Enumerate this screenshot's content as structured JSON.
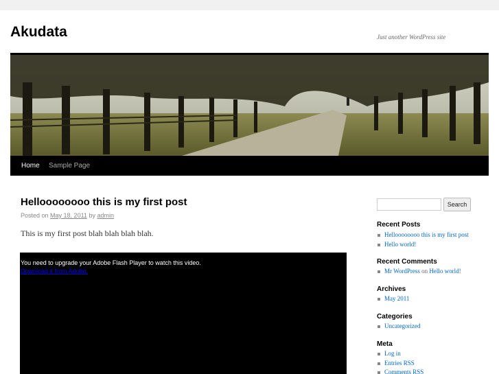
{
  "site": {
    "title": "Akudata",
    "description": "Just another WordPress site"
  },
  "nav": {
    "items": [
      {
        "label": "Home",
        "active": true
      },
      {
        "label": "Sample Page",
        "active": false
      }
    ]
  },
  "post": {
    "title": "Helloooooooo this is my first post",
    "meta": {
      "posted_on": "Posted on",
      "date": "May 18, 2011",
      "by": "by",
      "author": "admin"
    },
    "body": "This is my first post blah blah blah blah.",
    "flash": {
      "message": "You need to upgrade your Adobe Flash Player to watch this video.",
      "link": "Download it from Adobe."
    }
  },
  "sidebar": {
    "search": {
      "placeholder": "",
      "button": "Search"
    },
    "recent_posts": {
      "title": "Recent Posts",
      "items": [
        "Helloooooooo this is my first post",
        "Hello world!"
      ]
    },
    "recent_comments": {
      "title": "Recent Comments",
      "items": [
        {
          "author": "Mr WordPress",
          "on": "on",
          "post": "Hello world!"
        }
      ]
    },
    "archives": {
      "title": "Archives",
      "items": [
        "May 2011"
      ]
    },
    "categories": {
      "title": "Categories",
      "items": [
        "Uncategorized"
      ]
    },
    "meta": {
      "title": "Meta",
      "items": [
        "Log in",
        "Entries RSS",
        "Comments RSS"
      ]
    }
  },
  "colors": {
    "background": "#f1f1f1",
    "menu_bar": "#000000",
    "link": "#0066cc",
    "flash_link": "#0000ee"
  }
}
